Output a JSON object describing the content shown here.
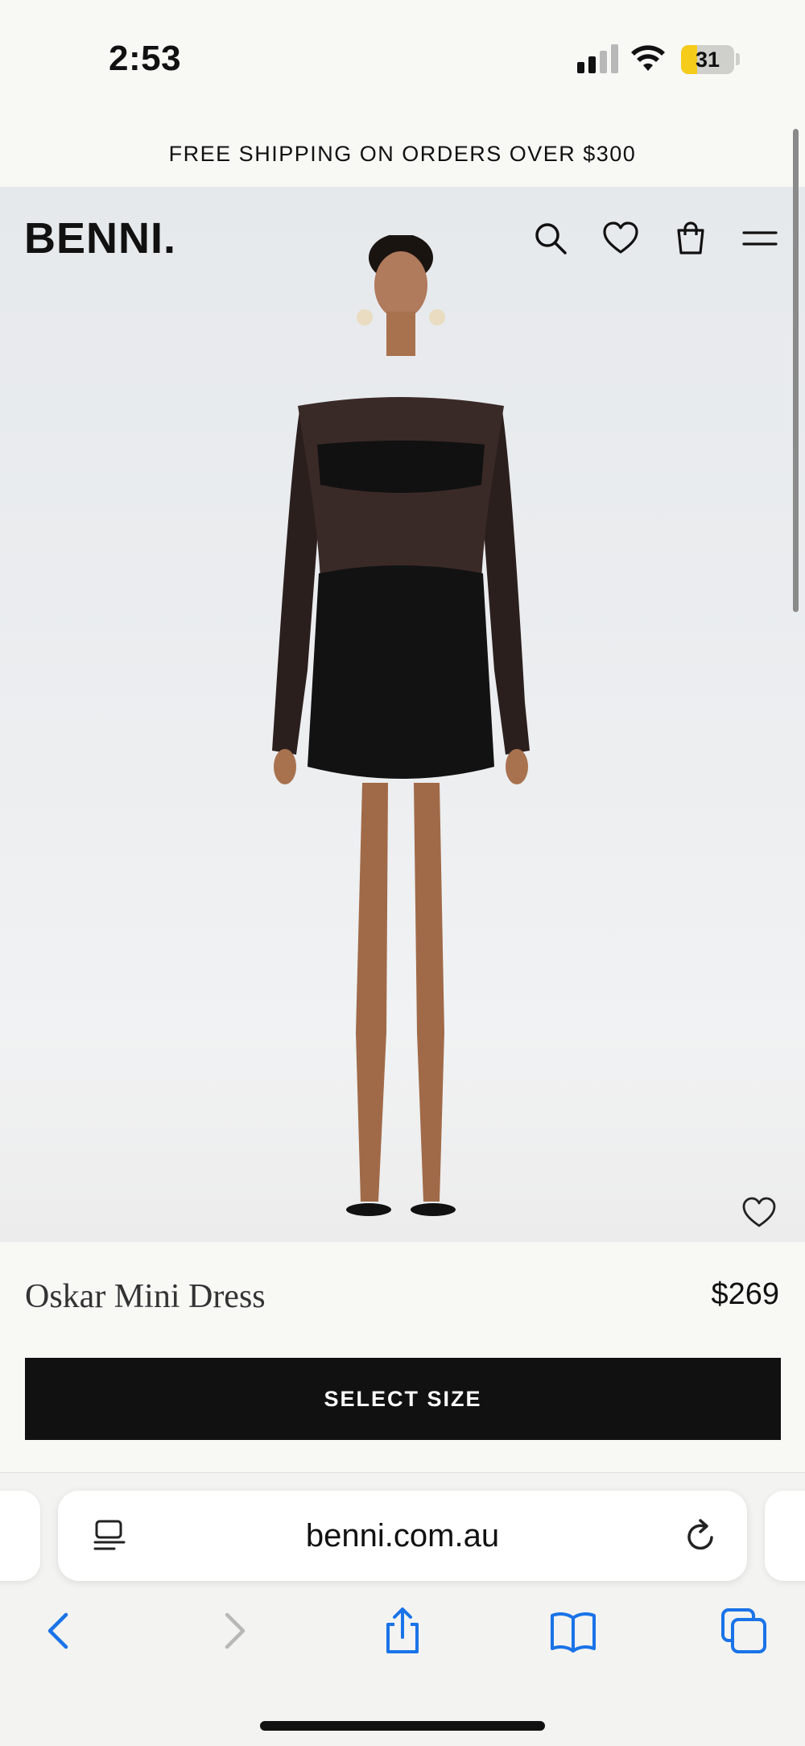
{
  "status_bar": {
    "time": "2:53",
    "battery_level": "31"
  },
  "announcement": "FREE SHIPPING ON ORDERS OVER $300",
  "header": {
    "logo": "BENNI.",
    "icons": [
      "search-icon",
      "heart-icon",
      "bag-icon",
      "menu-icon"
    ]
  },
  "product": {
    "name": "Oskar Mini Dress",
    "price": "$269",
    "cta_label": "SELECT SIZE",
    "wishlist_icon": "heart-icon"
  },
  "browser": {
    "url": "benni.com.au",
    "toolbar_icons": [
      "back-icon",
      "forward-icon",
      "share-icon",
      "bookmarks-icon",
      "tabs-icon"
    ],
    "accent_color": "#1a73e8"
  }
}
